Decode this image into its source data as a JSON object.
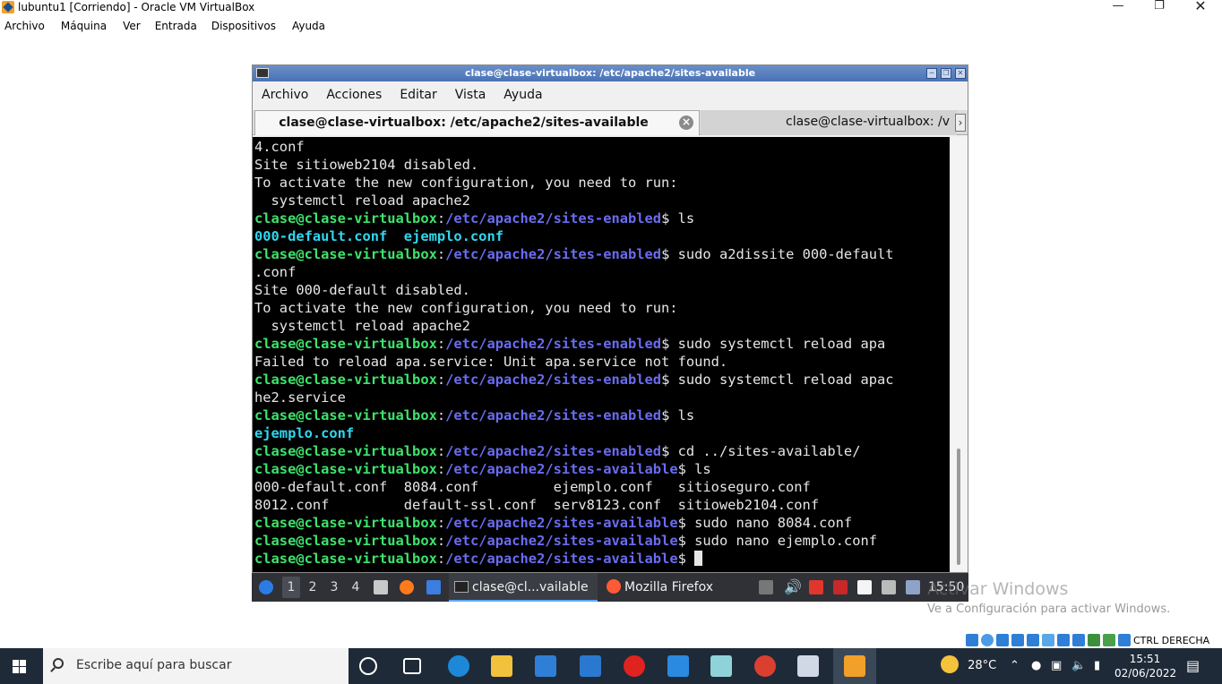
{
  "vbox": {
    "title": "lubuntu1 [Corriendo] - Oracle VM VirtualBox",
    "menu": [
      "Archivo",
      "Máquina",
      "Ver",
      "Entrada",
      "Dispositivos",
      "Ayuda"
    ],
    "status_host_key": "CTRL DERECHA"
  },
  "terminal": {
    "title": "clase@clase-virtualbox: /etc/apache2/sites-available",
    "menu": [
      "Archivo",
      "Acciones",
      "Editar",
      "Vista",
      "Ayuda"
    ],
    "tabs": [
      {
        "label": "clase@clase-virtualbox: /etc/apache2/sites-available",
        "active": true
      },
      {
        "label": "clase@clase-virtualbox: /v",
        "active": false
      }
    ],
    "lines": [
      {
        "t": "out",
        "text": "4.conf"
      },
      {
        "t": "out",
        "text": "Site sitioweb2104 disabled."
      },
      {
        "t": "out",
        "text": "To activate the new configuration, you need to run:"
      },
      {
        "t": "out",
        "text": "  systemctl reload apache2"
      },
      {
        "t": "prompt",
        "user": "clase@clase-virtualbox",
        "path": "/etc/apache2/sites-enabled",
        "cmd": " ls"
      },
      {
        "t": "files",
        "text": "000-default.conf  ejemplo.conf"
      },
      {
        "t": "prompt",
        "user": "clase@clase-virtualbox",
        "path": "/etc/apache2/sites-enabled",
        "cmd": " sudo a2dissite 000-default"
      },
      {
        "t": "out",
        "text": ".conf"
      },
      {
        "t": "out",
        "text": "Site 000-default disabled."
      },
      {
        "t": "out",
        "text": "To activate the new configuration, you need to run:"
      },
      {
        "t": "out",
        "text": "  systemctl reload apache2"
      },
      {
        "t": "prompt",
        "user": "clase@clase-virtualbox",
        "path": "/etc/apache2/sites-enabled",
        "cmd": " sudo systemctl reload apa"
      },
      {
        "t": "out",
        "text": "Failed to reload apa.service: Unit apa.service not found."
      },
      {
        "t": "prompt",
        "user": "clase@clase-virtualbox",
        "path": "/etc/apache2/sites-enabled",
        "cmd": " sudo systemctl reload apac"
      },
      {
        "t": "out",
        "text": "he2.service"
      },
      {
        "t": "prompt",
        "user": "clase@clase-virtualbox",
        "path": "/etc/apache2/sites-enabled",
        "cmd": " ls"
      },
      {
        "t": "files",
        "text": "ejemplo.conf"
      },
      {
        "t": "prompt",
        "user": "clase@clase-virtualbox",
        "path": "/etc/apache2/sites-enabled",
        "cmd": " cd ../sites-available/"
      },
      {
        "t": "prompt",
        "user": "clase@clase-virtualbox",
        "path": "/etc/apache2/sites-available",
        "cmd": " ls"
      },
      {
        "t": "out",
        "text": "000-default.conf  8084.conf         ejemplo.conf   sitioseguro.conf"
      },
      {
        "t": "out",
        "text": "8012.conf         default-ssl.conf  serv8123.conf  sitioweb2104.conf"
      },
      {
        "t": "prompt",
        "user": "clase@clase-virtualbox",
        "path": "/etc/apache2/sites-available",
        "cmd": " sudo nano 8084.conf"
      },
      {
        "t": "prompt",
        "user": "clase@clase-virtualbox",
        "path": "/etc/apache2/sites-available",
        "cmd": " sudo nano ejemplo.conf"
      },
      {
        "t": "prompt",
        "user": "clase@clase-virtualbox",
        "path": "/etc/apache2/sites-available",
        "cmd": " ",
        "cursor": true
      }
    ]
  },
  "lxqt_panel": {
    "desktops": [
      "1",
      "2",
      "3",
      "4"
    ],
    "tasks": [
      "clase@cl...vailable",
      "Mozilla Firefox"
    ],
    "clock": "15:50"
  },
  "activation": {
    "line1": "Activar Windows",
    "line2": "Ve a Configuración para activar Windows."
  },
  "windows_taskbar": {
    "search_placeholder": "Escribe aquí para buscar",
    "weather": "28°C",
    "time": "15:51",
    "date": "02/06/2022"
  }
}
